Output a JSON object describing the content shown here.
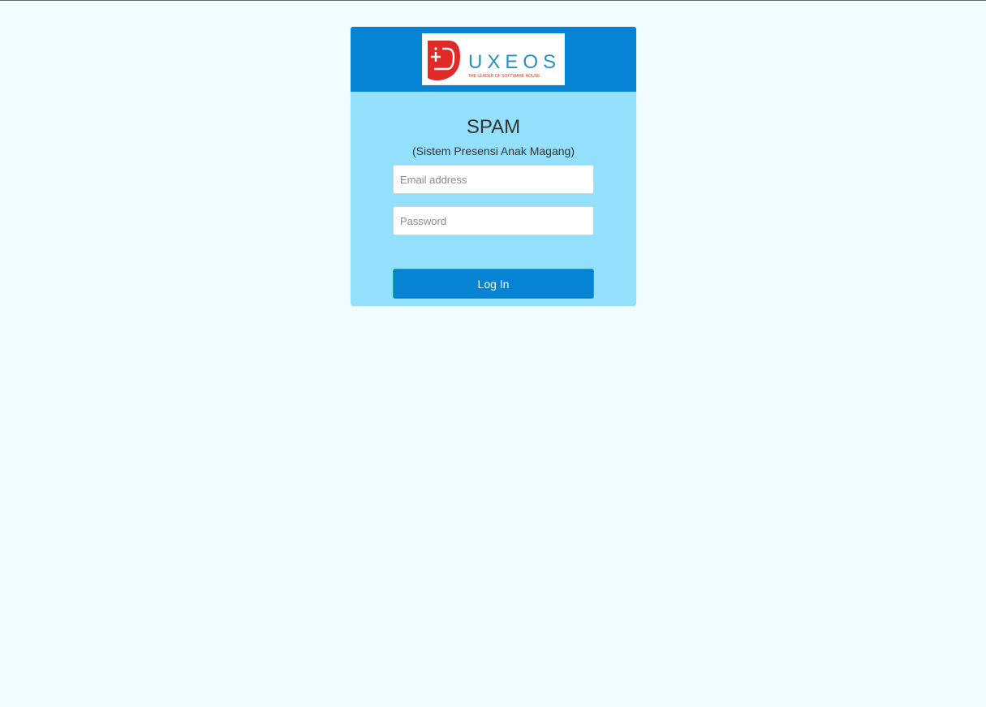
{
  "brand": {
    "logo_name": "UXEOS",
    "logo_tagline": "THE LEADER OF SOFTWARE HOUSE",
    "logo_red": "#e02a27",
    "logo_blue": "#2690c4"
  },
  "app": {
    "title": "SPAM",
    "subtitle": "(Sistem Presensi Anak Magang)"
  },
  "form": {
    "email": {
      "placeholder": "Email address",
      "value": ""
    },
    "password": {
      "placeholder": "Password",
      "value": ""
    },
    "submit_label": "Log In"
  },
  "colors": {
    "page_background": "#f1fdff",
    "header_background": "#0683d2",
    "card_background": "#93e0fd",
    "button_background": "#0683d2"
  }
}
